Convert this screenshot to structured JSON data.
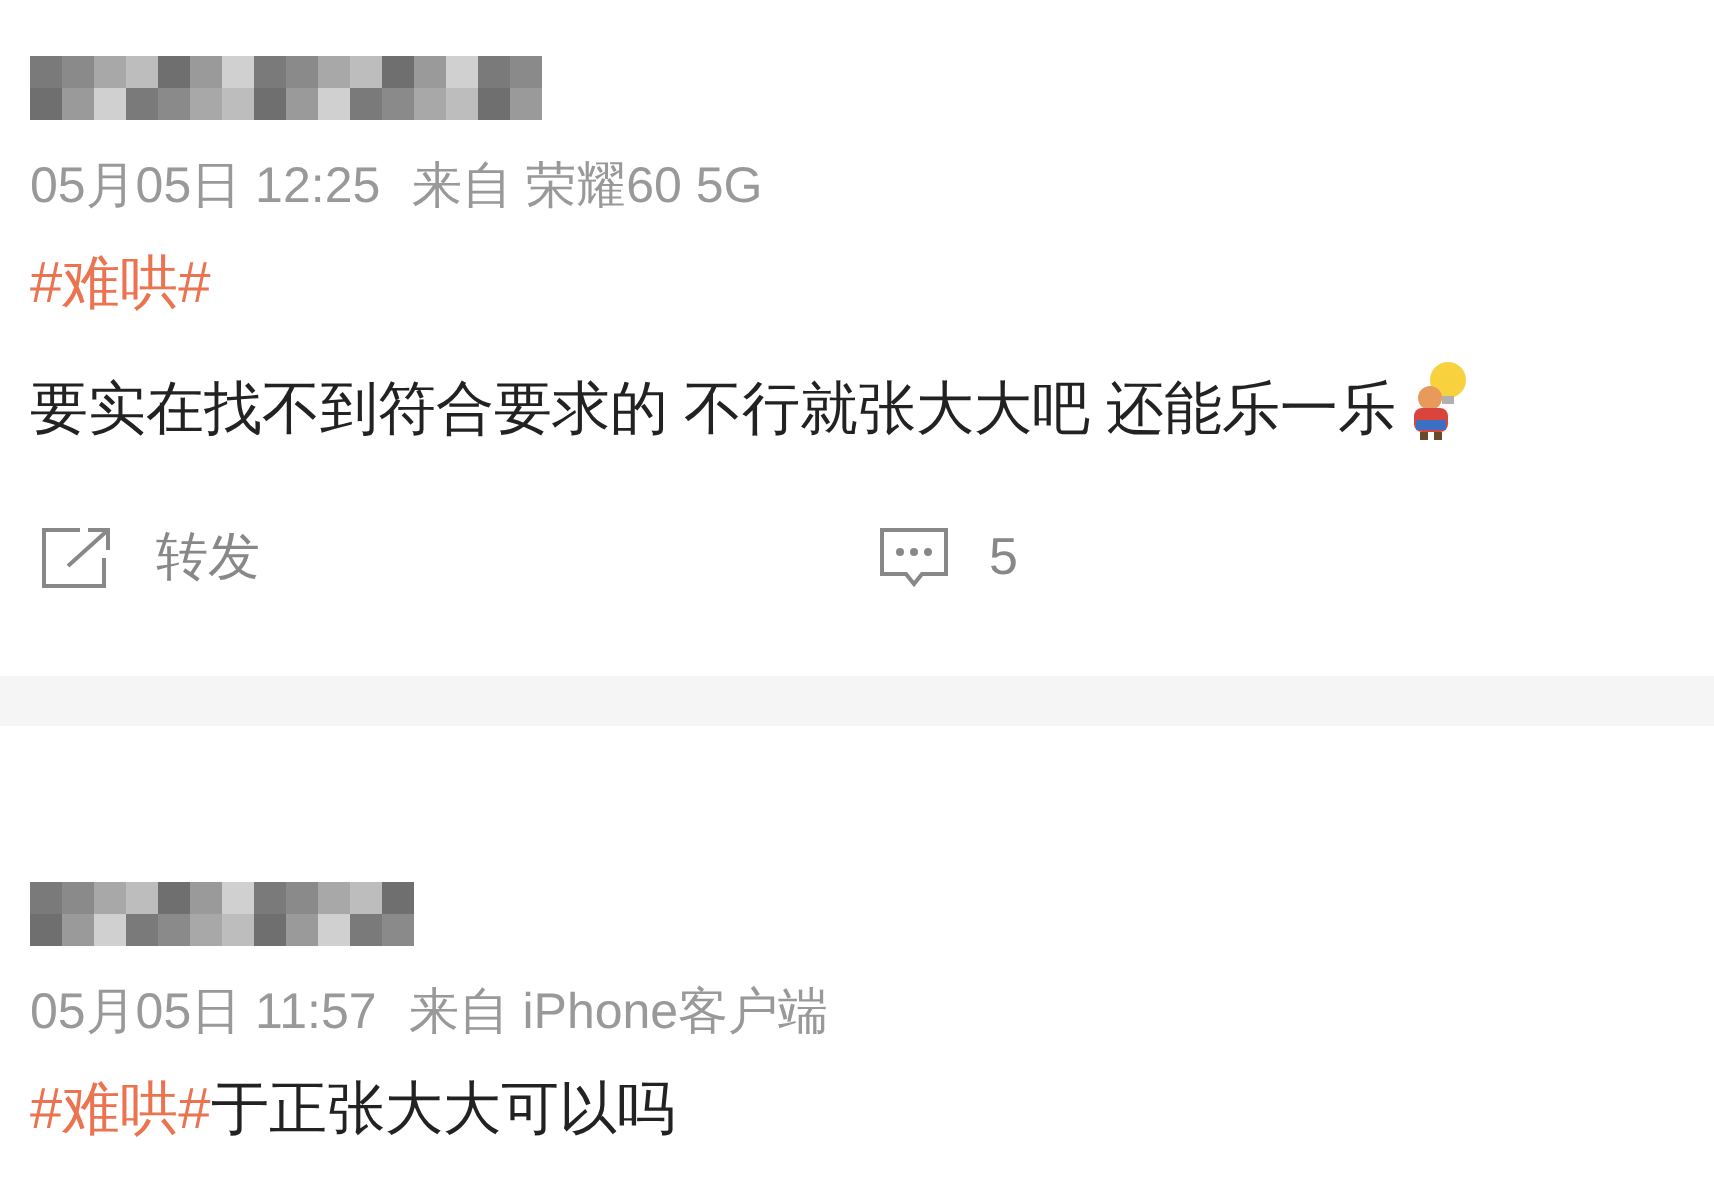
{
  "posts": [
    {
      "time": "05月05日 12:25",
      "source": "来自 荣耀60 5G",
      "paragraphs": [
        {
          "segments": [
            {
              "kind": "hashtag",
              "text": "#难哄#"
            }
          ]
        },
        {
          "segments": [
            {
              "kind": "text",
              "text": "要实在找不到符合要求的 不行就张大大吧 还能乐一乐"
            },
            {
              "kind": "emoji"
            }
          ]
        }
      ],
      "actions": [
        {
          "kind": "share",
          "label": "转发"
        },
        {
          "kind": "comment",
          "label": "5"
        }
      ]
    },
    {
      "time": "05月05日 11:57",
      "source": "来自 iPhone客户端",
      "paragraphs": [
        {
          "segments": [
            {
              "kind": "hashtag",
              "text": "#难哄#"
            },
            {
              "kind": "text",
              "text": "于正张大大可以吗"
            }
          ]
        }
      ]
    }
  ]
}
